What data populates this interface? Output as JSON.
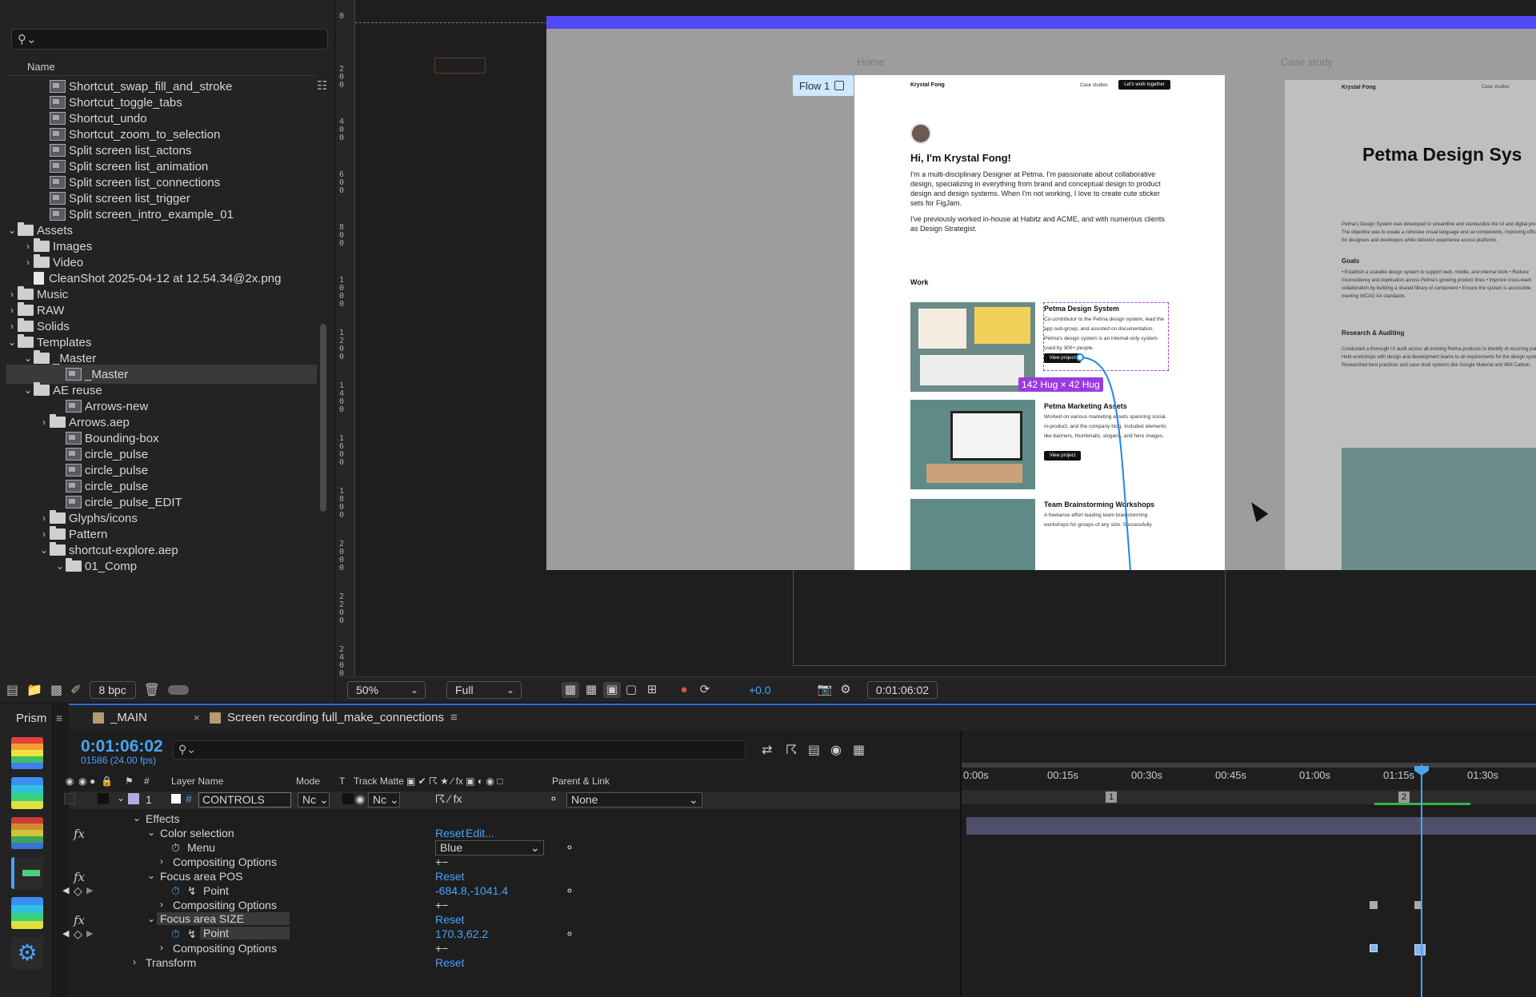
{
  "project": {
    "column_name": "Name",
    "items": [
      {
        "label": "Shortcut_swap_fill_and_stroke",
        "type": "comp",
        "indent": 2
      },
      {
        "label": "Shortcut_toggle_tabs",
        "type": "comp",
        "indent": 2
      },
      {
        "label": "Shortcut_undo",
        "type": "comp",
        "indent": 2
      },
      {
        "label": "Shortcut_zoom_to_selection",
        "type": "comp",
        "indent": 2
      },
      {
        "label": "Split screen list_actons",
        "type": "comp",
        "indent": 2
      },
      {
        "label": "Split screen list_animation",
        "type": "comp",
        "indent": 2
      },
      {
        "label": "Split screen list_connections",
        "type": "comp",
        "indent": 2
      },
      {
        "label": "Split screen list_trigger",
        "type": "comp",
        "indent": 2
      },
      {
        "label": "Split screen_intro_example_01",
        "type": "comp",
        "indent": 2
      },
      {
        "label": "Assets",
        "type": "folder",
        "indent": 0,
        "chev": "open"
      },
      {
        "label": "Images",
        "type": "folder",
        "indent": 1,
        "chev": "closed"
      },
      {
        "label": "Video",
        "type": "folder",
        "indent": 1,
        "chev": "closed"
      },
      {
        "label": "CleanShot 2025-04-12 at 12.54.34@2x.png",
        "type": "file",
        "indent": 1
      },
      {
        "label": "Music",
        "type": "folder",
        "indent": 0,
        "chev": "closed"
      },
      {
        "label": "RAW",
        "type": "folder",
        "indent": 0,
        "chev": "closed"
      },
      {
        "label": "Solids",
        "type": "folder",
        "indent": 0,
        "chev": "closed"
      },
      {
        "label": "Templates",
        "type": "folder",
        "indent": 0,
        "chev": "open"
      },
      {
        "label": "_Master",
        "type": "folder",
        "indent": 1,
        "chev": "open"
      },
      {
        "label": "_Master",
        "type": "comp",
        "indent": 3,
        "selected": true
      },
      {
        "label": "AE reuse",
        "type": "folder",
        "indent": 1,
        "chev": "open"
      },
      {
        "label": "Arrows-new",
        "type": "comp",
        "indent": 3
      },
      {
        "label": "Arrows.aep",
        "type": "folder",
        "indent": 2,
        "chev": "closed"
      },
      {
        "label": "Bounding-box",
        "type": "comp",
        "indent": 3
      },
      {
        "label": "circle_pulse",
        "type": "comp",
        "indent": 3
      },
      {
        "label": "circle_pulse",
        "type": "comp",
        "indent": 3
      },
      {
        "label": "circle_pulse",
        "type": "comp",
        "indent": 3
      },
      {
        "label": "circle_pulse_EDIT",
        "type": "comp",
        "indent": 3
      },
      {
        "label": "Glyphs/icons",
        "type": "folder",
        "indent": 2,
        "chev": "closed"
      },
      {
        "label": "Pattern",
        "type": "folder",
        "indent": 2,
        "chev": "closed"
      },
      {
        "label": "shortcut-explore.aep",
        "type": "folder",
        "indent": 2,
        "chev": "open"
      },
      {
        "label": "01_Comp",
        "type": "folder",
        "indent": 3,
        "chev": "open"
      }
    ],
    "bpc": "8 bpc"
  },
  "ruler_ticks": [
    "0",
    "200",
    "400",
    "600",
    "800",
    "1000",
    "1200",
    "1400",
    "1600",
    "1800",
    "2000",
    "2200",
    "2400"
  ],
  "canvas": {
    "home_label": "Home",
    "case_label": "Case study",
    "flow_label": "Flow 1",
    "page": {
      "logo": "Krystal Fong",
      "nav_case": "Case studies",
      "nav_cta": "Let's work together",
      "greeting": "Hi, I'm Krystal Fong!",
      "bio": "I'm a multi-disciplinary Designer at Petma. I'm passionate about collaborative design, specializing in everything from brand and conceptual design to product design and design systems. When I'm not working, I love to create cute sticker sets for FigJam.",
      "bio2": "I've previously worked in-house at Habitz and ACME, and with numerous clients as Design Strategist.",
      "work_heading": "Work",
      "projects": [
        {
          "title": "Petma Design System",
          "desc": "Co-contributor to the Petma design system, lead the app sub-group, and assisted on documentation. Petma's design system is an internal-only system used by 300+ people.",
          "button": "View project"
        },
        {
          "title": "Petma Marketing Assets",
          "desc": "Worked on various marketing assets spanning social, in-product, and the company blog. Included elements like banners, thumbnails, slogans, and hero images.",
          "button": "View project"
        },
        {
          "title": "Team Brainstorming Workshops",
          "desc": "A freelance effort leading team brainstorming workshops for groups of any size. Successfully",
          "button": ""
        }
      ],
      "hug_badge": "142 Hug × 42 Hug"
    },
    "page2": {
      "logo": "Krystal Fong",
      "nav": "Case studies",
      "title": "Petma Design Sys",
      "intro": "Petma's Design System was developed to streamline and standardize the UI and digital products. The objective was to create a cohesive visual language and se components, improving efficiency for designers and developers while deliverin experience across platforms.",
      "goals_heading": "Goals",
      "goals": "• Establish a scalable design system to support web, mobile, and internal tools • Reduce inconsistency and duplication across Petma's growing product lines • Improve cross-team collaboration by building a shared library of component • Ensure the system is accessible, meeting WCAG AA standards.",
      "research_heading": "Research & Auditing",
      "research": "Conducted a thorough UI audit across all existing Petma products to identify di recurring patterns. Held workshops with design and development teams to ali requirements for the design system. Researched best practices and case studi systems like Google Material and IBM Carbon."
    }
  },
  "viewer_footer": {
    "zoom": "50%",
    "resolution": "Full",
    "exposure": "+0.0",
    "timecode": "0:01:06:02"
  },
  "left_tools": {
    "title": "Prism"
  },
  "timeline": {
    "tabs": [
      {
        "label": "_MAIN"
      },
      {
        "label": "Screen recording full_make_connections"
      }
    ],
    "current_time": "0:01:06:02",
    "frame_info": "01586 (24.00 fps)",
    "columns": {
      "num": "#",
      "layer_name": "Layer Name",
      "mode": "Mode",
      "t": "T",
      "track_matte": "Track Matte",
      "parent": "Parent & Link"
    },
    "layer": {
      "index": "1",
      "name": "CONTROLS",
      "mode": "Nc",
      "matte": "Nc",
      "parent": "None"
    },
    "rows": {
      "effects": "Effects",
      "color_selection": "Color selection",
      "reset": "Reset",
      "edit": "Edit...",
      "menu": "Menu",
      "menu_value": "Blue",
      "compositing": "Compositing Options",
      "focus_pos": "Focus area POS",
      "point": "Point",
      "pos_value": "-684.8,-1041.4",
      "focus_size": "Focus area SIZE",
      "size_value": "170.3,62.2",
      "transform": "Transform",
      "plusminus": "+−"
    },
    "ruler": [
      "0:00s",
      "00:15s",
      "00:30s",
      "00:45s",
      "01:00s",
      "01:15s",
      "01:30s"
    ],
    "markers": [
      "1",
      "2"
    ]
  }
}
